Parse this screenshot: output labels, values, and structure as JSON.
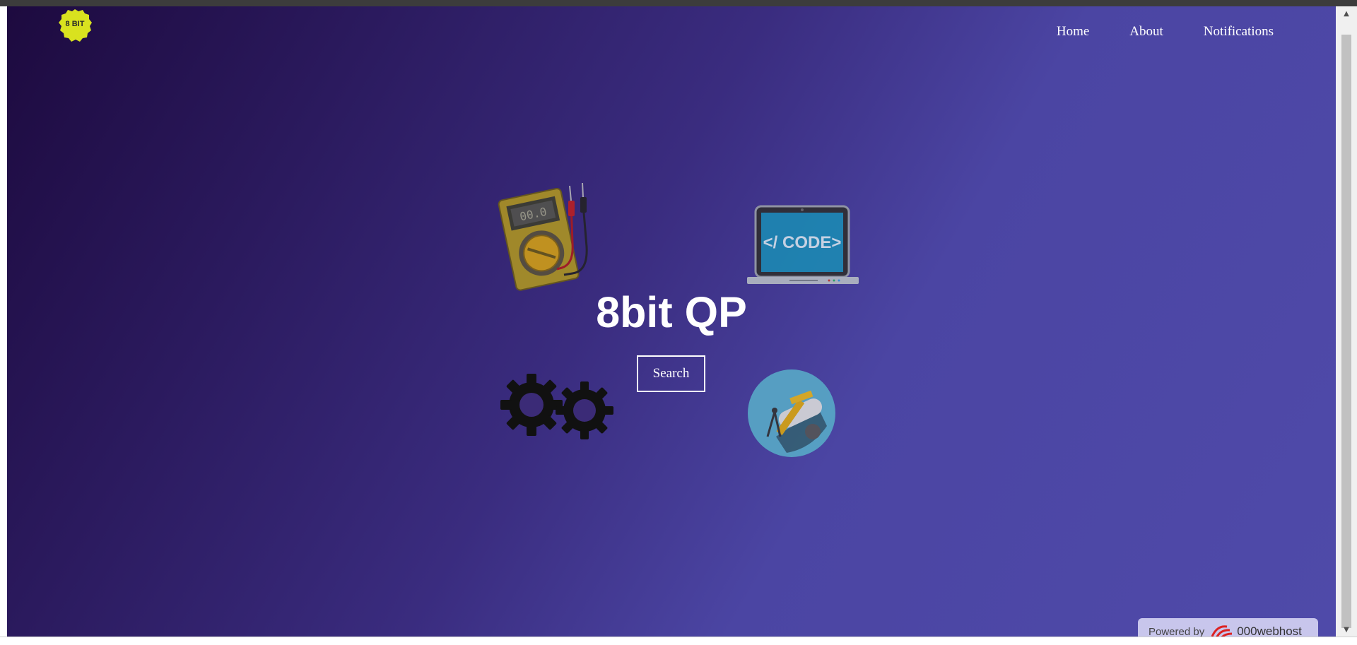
{
  "header": {
    "logo_text": "8 BIT",
    "nav": [
      {
        "label": "Home"
      },
      {
        "label": "About"
      },
      {
        "label": "Notifications"
      }
    ]
  },
  "hero": {
    "title": "8bit QP",
    "search_label": "Search",
    "laptop_screen_text": "</ CODE>",
    "multimeter_display": "00.0"
  },
  "footer": {
    "powered_by": "Powered by",
    "brand": "000webhost"
  },
  "colors": {
    "gradient_dark": "#1d0a3f",
    "gradient_light": "#4f4aa9",
    "logo_yellow": "#d9e21f",
    "text": "#ffffff"
  }
}
